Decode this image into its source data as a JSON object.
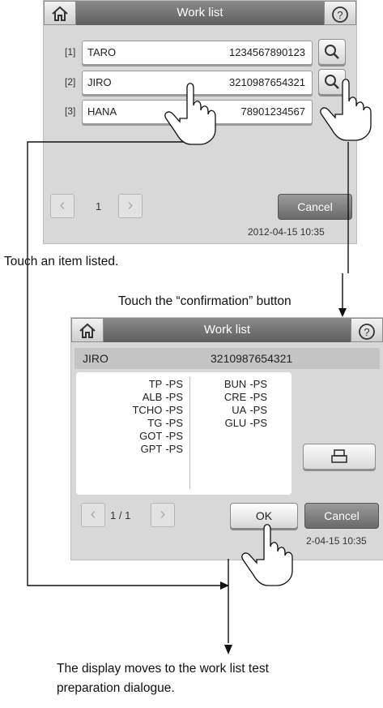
{
  "screen1": {
    "title": "Work list",
    "rows": [
      {
        "index": "[1]",
        "name": "TARO",
        "id": "1234567890123"
      },
      {
        "index": "[2]",
        "name": "JIRO",
        "id": "3210987654321"
      },
      {
        "index": "[3]",
        "name": "HANA",
        "id": "78901234567"
      }
    ],
    "page": "1",
    "cancel_label": "Cancel",
    "timestamp": "2012-04-15 10:35"
  },
  "screen2": {
    "title": "Work list",
    "patient_name": "JIRO",
    "patient_id": "3210987654321",
    "tests_left": [
      {
        "name": "TP",
        "result": "-PS"
      },
      {
        "name": "ALB",
        "result": "-PS"
      },
      {
        "name": "TCHO",
        "result": "-PS"
      },
      {
        "name": "TG",
        "result": "-PS"
      },
      {
        "name": "GOT",
        "result": "-PS"
      },
      {
        "name": "GPT",
        "result": "-PS"
      }
    ],
    "tests_right": [
      {
        "name": "BUN",
        "result": "-PS"
      },
      {
        "name": "CRE",
        "result": "-PS"
      },
      {
        "name": "UA",
        "result": "-PS"
      },
      {
        "name": "GLU",
        "result": "-PS"
      }
    ],
    "page": "1 / 1",
    "ok_label": "OK",
    "cancel_label": "Cancel",
    "timestamp": "2-04-15 10:35"
  },
  "captions": {
    "touch_item": "Touch an item listed.",
    "touch_confirm": "Touch the “confirmation” button",
    "result_line1": "The display moves to the work list test",
    "result_line2": "preparation dialogue."
  },
  "icons": [
    "home-icon",
    "help-icon",
    "search-icon",
    "print-icon",
    "chevron-left-icon",
    "chevron-right-icon",
    "pointing-hand-icon"
  ]
}
